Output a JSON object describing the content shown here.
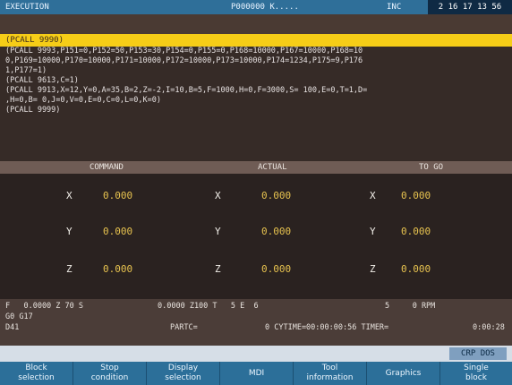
{
  "title_bar": {
    "mode": "EXECUTION",
    "program": "P000000 K.....",
    "unit": "INC",
    "date": "2 16 17 13 56"
  },
  "active_block": "(PCALL 9990)",
  "program_lines": [
    "(PCALL 9993,P151=0,P152=50,P153=30,P154=0,P155=0,P168=10000,P167=10000,P168=10",
    "0,P169=10000,P170=10000,P171=10000,P172=10000,P173=10000,P174=1234,P175=9,P176",
    "1,P177=1)",
    "(PCALL 9613,C=1)",
    "(PCALL 9913,X=12,Y=0,A=35,B=2,Z=-2,I=10,B=5,F=1000,H=0,F=3000,S= 100,E=0,T=1,D=",
    ",H=0,B= 0,J=0,V=0,E=0,C=0,L=0,K=0)",
    "(PCALL 9999)"
  ],
  "position_headers": {
    "command": "COMMAND",
    "actual": "ACTUAL",
    "to_go": "TO GO"
  },
  "axes": [
    {
      "axis": "X",
      "command": "0.000",
      "actual": "0.000",
      "to_go": "0.000"
    },
    {
      "axis": "Y",
      "command": "0.000",
      "actual": "0.000",
      "to_go": "0.000"
    },
    {
      "axis": "Z",
      "command": "0.000",
      "actual": "0.000",
      "to_go": "0.000"
    }
  ],
  "status": {
    "line1_left": "F   0.0000 Z 70 S",
    "line1_mid": "0.0000 Z100 T   5 E  6",
    "line1_right": "5     0 RPM",
    "line2": "G0 G17",
    "line3_left": "D41",
    "line3_partc": "PARTC=",
    "line3_cycle": "0 CYTIME=00:00:00:56 TIMER=",
    "line3_timer": "0:00:28"
  },
  "crdos_label": "CRP DOS",
  "softkeys": [
    {
      "line1": "Block",
      "line2": "selection"
    },
    {
      "line1": "Stop",
      "line2": "condition"
    },
    {
      "line1": "Display",
      "line2": "selection"
    },
    {
      "line1": "MDI",
      "line2": ""
    },
    {
      "line1": "Tool",
      "line2": "information"
    },
    {
      "line1": "Graphics",
      "line2": ""
    },
    {
      "line1": "Single",
      "line2": "block"
    }
  ]
}
